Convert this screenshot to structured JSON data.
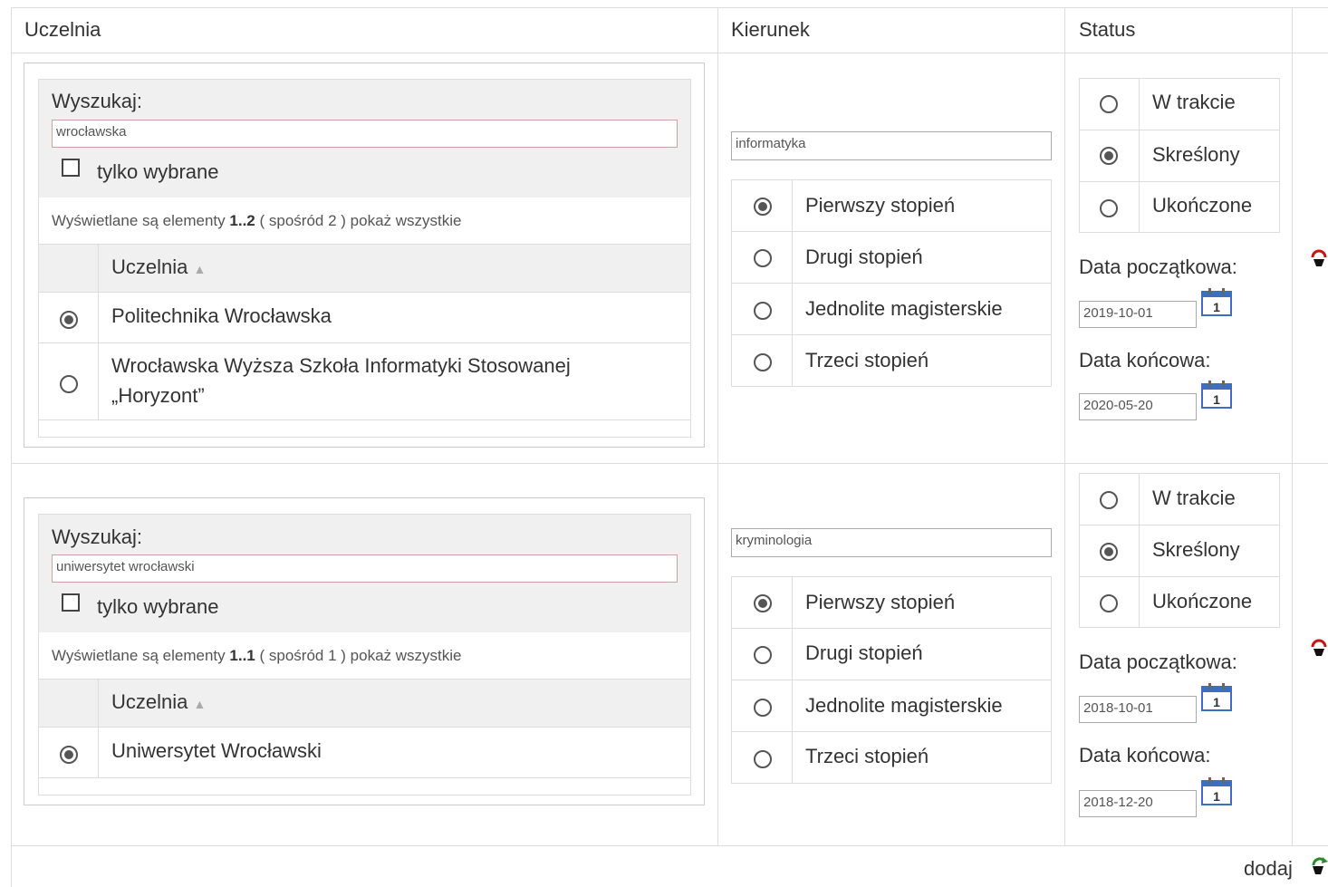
{
  "headers": {
    "uczelnia": "Uczelnia",
    "kierunek": "Kierunek",
    "status": "Status"
  },
  "rows": [
    {
      "search_label": "Wyszukaj:",
      "search_value": "wrocławska",
      "only_selected_label": "tylko wybrane",
      "info_prefix": "Wyświetlane są elementy",
      "info_range": "1..2",
      "info_mid": "( spośród 2 )",
      "info_link": "pokaż wszystkie",
      "col_header": "Uczelnia",
      "schools": [
        "Politechnika Wrocławska",
        "Wrocławska Wyższa Szkoła Informatyki Stosowanej",
        "„Horyzont”"
      ],
      "kierunek_value": "informatyka",
      "stopnie": [
        "Pierwszy stopień",
        "Drugi stopień",
        "Jednolite magisterskie",
        "Trzeci stopień"
      ],
      "statuses": [
        "W trakcie",
        "Skreślony",
        "Ukończone"
      ],
      "start_label": "Data początkowa:",
      "start_value": "2019-10-01",
      "end_label": "Data końcowa:",
      "end_value": "2020-05-20"
    },
    {
      "search_label": "Wyszukaj:",
      "search_value": "uniwersytet wrocławski",
      "only_selected_label": "tylko wybrane",
      "info_prefix": "Wyświetlane są elementy",
      "info_range": "1..1",
      "info_mid": "( spośród 1 )",
      "info_link": "pokaż wszystkie",
      "col_header": "Uczelnia",
      "schools": [
        "Uniwersytet Wrocławski"
      ],
      "kierunek_value": "kryminologia",
      "stopnie": [
        "Pierwszy stopień",
        "Drugi stopień",
        "Jednolite magisterskie",
        "Trzeci stopień"
      ],
      "statuses": [
        "W trakcie",
        "Skreślony",
        "Ukończone"
      ],
      "start_label": "Data początkowa:",
      "start_value": "2018-10-01",
      "end_label": "Data końcowa:",
      "end_value": "2018-12-20"
    }
  ],
  "calendar_day": "1",
  "footer": {
    "add_label": "dodaj"
  },
  "icons": {
    "calendar": "calendar-icon",
    "remove": "remove-icon",
    "add": "add-icon"
  },
  "colors": {
    "remove_icon": "#cc1111",
    "add_icon": "#2a8a2a",
    "calendar_blue": "#3a6fc4"
  }
}
